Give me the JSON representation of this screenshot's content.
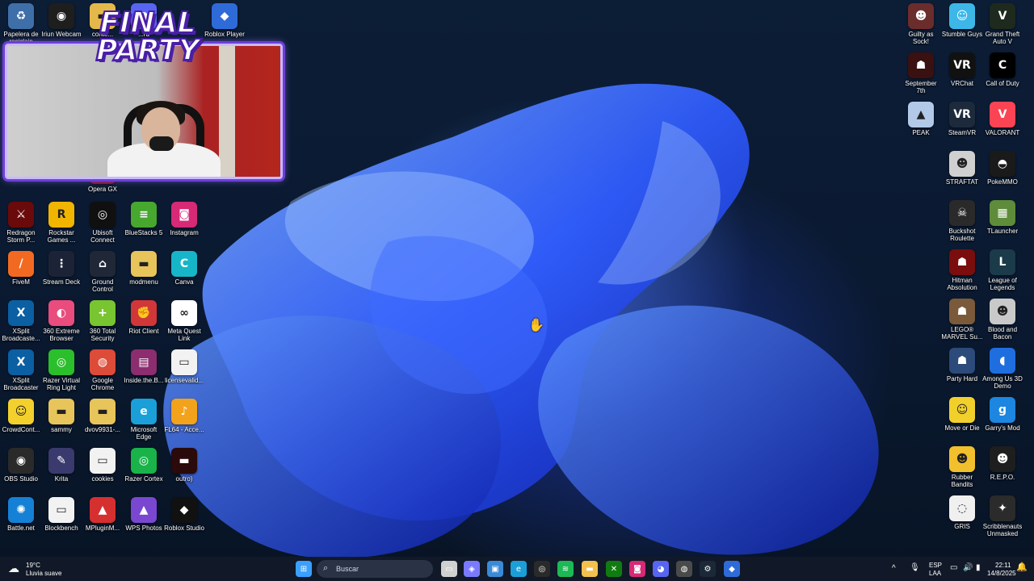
{
  "desktop": {
    "left_icons": [
      {
        "label": "Papelera de reciclaje",
        "icon": "recycle-bin-icon",
        "color": "#3f6fa8",
        "glyph": "♻"
      },
      {
        "label": "Iriun Webcam",
        "icon": "webcam-icon",
        "color": "#1e1e1e",
        "glyph": "◉"
      },
      {
        "label": "conte...",
        "icon": "folder-icon",
        "color": "#e5b84a",
        "glyph": "▬"
      },
      {
        "label": "...rd",
        "icon": "discord-icon",
        "color": "#5865f2",
        "glyph": "◕"
      },
      {
        "label": "Roblox Player",
        "icon": "roblox-icon",
        "color": "#2f6bd8",
        "glyph": "◆"
      },
      {
        "label": "Opera GX",
        "icon": "opera-gx-icon",
        "color": "#7a1426",
        "glyph": "O"
      },
      {
        "label": "Redragon Storm P...",
        "icon": "redragon-icon",
        "color": "#6a0a0a",
        "glyph": "⚔"
      },
      {
        "label": "Rockstar Games ...",
        "icon": "rockstar-icon",
        "color": "#f1b500",
        "glyph": "R"
      },
      {
        "label": "Ubisoft Connect",
        "icon": "ubisoft-icon",
        "color": "#101010",
        "glyph": "◎"
      },
      {
        "label": "BlueStacks 5",
        "icon": "bluestacks-icon",
        "color": "#47a72f",
        "glyph": "≡"
      },
      {
        "label": "Instagram",
        "icon": "instagram-icon",
        "color": "#d62976",
        "glyph": "◙"
      },
      {
        "label": "FiveM",
        "icon": "fivem-icon",
        "color": "#f26a21",
        "glyph": "/"
      },
      {
        "label": "Stream Deck",
        "icon": "stream-deck-icon",
        "color": "#1d2336",
        "glyph": "⋮"
      },
      {
        "label": "Ground Control",
        "icon": "ground-control-icon",
        "color": "#202838",
        "glyph": "⌂"
      },
      {
        "label": "modmenu",
        "icon": "folder-icon",
        "color": "#e8c55a",
        "glyph": "▬"
      },
      {
        "label": "Canva",
        "icon": "canva-icon",
        "color": "#16b6c8",
        "glyph": "C"
      },
      {
        "label": "XSplit Broadcaste...",
        "icon": "xsplit-icon",
        "color": "#0b5fa3",
        "glyph": "X"
      },
      {
        "label": "360 Extreme Browser",
        "icon": "360-browser-icon",
        "color": "#e94c7d",
        "glyph": "◐"
      },
      {
        "label": "360 Total Security",
        "icon": "360-security-icon",
        "color": "#79c431",
        "glyph": "+"
      },
      {
        "label": "Riot Client",
        "icon": "riot-client-icon",
        "color": "#d13639",
        "glyph": "✊"
      },
      {
        "label": "Meta Quest Link",
        "icon": "meta-quest-icon",
        "color": "#ffffff",
        "glyph": "∞"
      },
      {
        "label": "XSplit Broadcaster",
        "icon": "xsplit-icon",
        "color": "#0b5fa3",
        "glyph": "X"
      },
      {
        "label": "Razer Virtual Ring Light",
        "icon": "razer-ring-light-icon",
        "color": "#2bbf2b",
        "glyph": "◎"
      },
      {
        "label": "Google Chrome",
        "icon": "chrome-icon",
        "color": "#dd4b39",
        "glyph": "◍"
      },
      {
        "label": "Inside.the.B...",
        "icon": "winrar-icon",
        "color": "#8b2d6e",
        "glyph": "▤"
      },
      {
        "label": "licensevalid...",
        "icon": "file-icon",
        "color": "#f2f2f2",
        "glyph": "▭"
      },
      {
        "label": "CrowdCont...",
        "icon": "crowd-control-icon",
        "color": "#f4d02c",
        "glyph": "☺"
      },
      {
        "label": "sammy",
        "icon": "folder-icon",
        "color": "#e8c55a",
        "glyph": "▬"
      },
      {
        "label": "dvov9931-...",
        "icon": "folder-icon",
        "color": "#e8c55a",
        "glyph": "▬"
      },
      {
        "label": "Microsoft Edge",
        "icon": "edge-icon",
        "color": "#1a9fd9",
        "glyph": "e"
      },
      {
        "label": "FL64 - Acce...",
        "icon": "fl-studio-icon",
        "color": "#f2a21b",
        "glyph": "♪"
      },
      {
        "label": "OBS Studio",
        "icon": "obs-icon",
        "color": "#2a2a2a",
        "glyph": "◉"
      },
      {
        "label": "Krita",
        "icon": "krita-icon",
        "color": "#3a3a6e",
        "glyph": "✎"
      },
      {
        "label": "cookies",
        "icon": "file-icon",
        "color": "#f2f2f2",
        "glyph": "▭"
      },
      {
        "label": "Razer Cortex",
        "icon": "razer-cortex-icon",
        "color": "#19b34a",
        "glyph": "◎"
      },
      {
        "label": "outro)",
        "icon": "video-file-icon",
        "color": "#2a0a0a",
        "glyph": "▬"
      },
      {
        "label": "Battle.net",
        "icon": "battlenet-icon",
        "color": "#1581d6",
        "glyph": "✺"
      },
      {
        "label": "Blockbench",
        "icon": "file-icon",
        "color": "#f2f2f2",
        "glyph": "▭"
      },
      {
        "label": "MPluginM...",
        "icon": "mplugin-icon",
        "color": "#d5302f",
        "glyph": "▲"
      },
      {
        "label": "WPS Photos",
        "icon": "wps-photos-icon",
        "color": "#7a47d1",
        "glyph": "▲"
      },
      {
        "label": "Roblox Studio",
        "icon": "roblox-studio-icon",
        "color": "#111111",
        "glyph": "◆"
      }
    ],
    "right_icons": [
      {
        "label": "Guilty as Sock!",
        "icon": "guilty-as-sock-icon",
        "color": "#6b2c2c",
        "glyph": "☻"
      },
      {
        "label": "Stumble Guys",
        "icon": "stumble-guys-icon",
        "color": "#3cb7e8",
        "glyph": "☺"
      },
      {
        "label": "Grand Theft Auto V",
        "icon": "gta-v-icon",
        "color": "#1e2a1e",
        "glyph": "V"
      },
      {
        "label": "September 7th",
        "icon": "september-7th-icon",
        "color": "#3a1010",
        "glyph": "☗"
      },
      {
        "label": "VRChat",
        "icon": "vrchat-icon",
        "color": "#111111",
        "glyph": "VR"
      },
      {
        "label": "Call of Duty",
        "icon": "call-of-duty-icon",
        "color": "#000000",
        "glyph": "C"
      },
      {
        "label": "PEAK",
        "icon": "peak-icon",
        "color": "#b2c9e8",
        "glyph": "▲"
      },
      {
        "label": "SteamVR",
        "icon": "steamvr-icon",
        "color": "#1d2a3c",
        "glyph": "VR"
      },
      {
        "label": "VALORANT",
        "icon": "valorant-icon",
        "color": "#fa4454",
        "glyph": "V"
      },
      {
        "label": "STRAFTAT",
        "icon": "straftat-icon",
        "color": "#d0d0d0",
        "glyph": "☻"
      },
      {
        "label": "PokeMMO",
        "icon": "pokemmo-icon",
        "color": "#1a1a1a",
        "glyph": "◓"
      },
      {
        "label": "Buckshot Roulette",
        "icon": "buckshot-roulette-icon",
        "color": "#2a2a2a",
        "glyph": "☠"
      },
      {
        "label": "TLauncher",
        "icon": "tlauncher-icon",
        "color": "#5e8c3a",
        "glyph": "▦"
      },
      {
        "label": "Hitman Absolution",
        "icon": "hitman-icon",
        "color": "#7a0d0d",
        "glyph": "☗"
      },
      {
        "label": "League of Legends",
        "icon": "league-icon",
        "color": "#1b3a4a",
        "glyph": "L"
      },
      {
        "label": "LEGO® MARVEL Su...",
        "icon": "lego-marvel-icon",
        "color": "#7a5a3a",
        "glyph": "☗"
      },
      {
        "label": "Blood and Bacon",
        "icon": "blood-and-bacon-icon",
        "color": "#c9c9c9",
        "glyph": "☻"
      },
      {
        "label": "Party Hard",
        "icon": "party-hard-icon",
        "color": "#2c4a7a",
        "glyph": "☗"
      },
      {
        "label": "Among Us 3D Demo",
        "icon": "among-us-icon",
        "color": "#1f6ee0",
        "glyph": "◖"
      },
      {
        "label": "Move or Die",
        "icon": "move-or-die-icon",
        "color": "#f2d02c",
        "glyph": "☺"
      },
      {
        "label": "Garry's Mod",
        "icon": "garrys-mod-icon",
        "color": "#1c86e0",
        "glyph": "g"
      },
      {
        "label": "Rubber Bandits",
        "icon": "rubber-bandits-icon",
        "color": "#f2c02c",
        "glyph": "☻"
      },
      {
        "label": "R.E.P.O.",
        "icon": "repo-icon",
        "color": "#1e1e1e",
        "glyph": "☻"
      },
      {
        "label": "GRIS",
        "icon": "gris-icon",
        "color": "#f0f0f0",
        "glyph": "◌"
      },
      {
        "label": "Scribblenauts Unmasked",
        "icon": "scribblenauts-icon",
        "color": "#2b2b2b",
        "glyph": "✦"
      }
    ]
  },
  "overlay": {
    "title": "FINAL PARTY"
  },
  "taskbar": {
    "weather_temp": "19°C",
    "weather_desc": "Lluvia suave",
    "search_placeholder": "Buscar",
    "pinned": [
      {
        "name": "start-button",
        "glyph": "⊞",
        "color": "#3aa0ff"
      },
      {
        "name": "task-view-icon",
        "glyph": "▭",
        "color": "#d0d0d0"
      },
      {
        "name": "copilot-icon",
        "glyph": "◈",
        "color": "#7a7aff"
      },
      {
        "name": "microsoft-store-icon",
        "glyph": "▣",
        "color": "#3a8ad8"
      },
      {
        "name": "edge-icon",
        "glyph": "e",
        "color": "#1a9fd9"
      },
      {
        "name": "game-overlay-icon",
        "glyph": "◎",
        "color": "#2a2a2a"
      },
      {
        "name": "spotify-icon",
        "glyph": "≋",
        "color": "#1db954"
      },
      {
        "name": "file-explorer-icon",
        "glyph": "▬",
        "color": "#f2c14e"
      },
      {
        "name": "xbox-icon",
        "glyph": "✕",
        "color": "#107c10"
      },
      {
        "name": "instagram-icon",
        "glyph": "◙",
        "color": "#d62976"
      },
      {
        "name": "discord-icon",
        "glyph": "◕",
        "color": "#5865f2"
      },
      {
        "name": "chrome-icon",
        "glyph": "◍",
        "color": "#4a4a4a"
      },
      {
        "name": "steam-icon",
        "glyph": "⚙",
        "color": "#1b2838"
      },
      {
        "name": "roblox-icon",
        "glyph": "◆",
        "color": "#2f6bd8"
      }
    ],
    "lang_top": "ESP",
    "lang_bottom": "LAA",
    "time": "22:11",
    "date": "14/8/2025"
  }
}
